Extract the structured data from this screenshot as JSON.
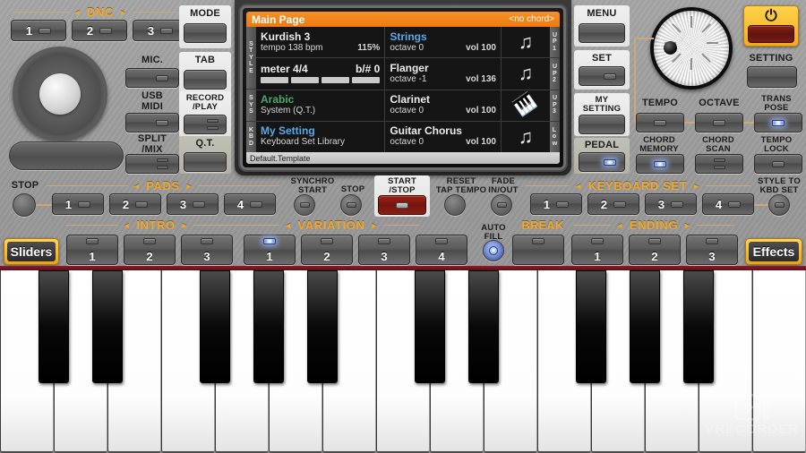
{
  "lcd": {
    "title": "Main Page",
    "chord": "<no chord>",
    "footer": "Default.Template",
    "side_left": [
      "STYLE",
      "SYS",
      "KBD"
    ],
    "side_right": [
      "UP1",
      "UP2",
      "UP3",
      "Low"
    ],
    "rows": [
      {
        "left_title": "Kurdish 3",
        "left_sub_a": "tempo 138 bpm",
        "left_sub_b": "115%",
        "right_title": "Strings",
        "right_sub_a": "octave 0",
        "right_sub_b": "vol 100",
        "icon": "music-note-icon"
      },
      {
        "left_title": "meter 4/4",
        "left_sub_a": "b/# 0",
        "left_sub_b": "",
        "right_title": "Flanger",
        "right_sub_a": "octave -1",
        "right_sub_b": "vol 136",
        "icon": "music-note-icon"
      },
      {
        "left_title": "Arabic",
        "left_sub_a": "System (Q.T.)",
        "left_sub_b": "",
        "right_title": "Clarinet",
        "right_sub_a": "octave 0",
        "right_sub_b": "vol 100",
        "icon": "clarinet-icon"
      },
      {
        "left_title": "My Setting",
        "left_sub_a": "Keyboard Set Library",
        "left_sub_b": "",
        "right_title": "Guitar Chorus",
        "right_sub_a": "octave 0",
        "right_sub_b": "vol 100",
        "icon": "music-note-icon"
      }
    ],
    "beat_segments": 4
  },
  "left_panel": {
    "dnc_label": "DNC",
    "dnc_buttons": [
      "1",
      "2",
      "3"
    ],
    "mic_label": "MIC.",
    "usb_midi_label": "USB\nMIDI",
    "split_mix_label": "SPLIT\n/MIX",
    "jog_wheel": "jog-wheel",
    "pitch_bar": "pitch-bend-bar"
  },
  "mode_column": {
    "items": [
      "MODE",
      "TAB",
      "RECORD\n/PLAY",
      "Q.T."
    ]
  },
  "right_column": {
    "items": [
      "MENU",
      "SET",
      "MY\nSETTING",
      "PEDAL"
    ]
  },
  "right_panel": {
    "dial": "value-dial",
    "power_label": "power-icon",
    "setting_label": "SETTING",
    "row1": [
      "TEMPO",
      "OCTAVE",
      "TRANS\nPOSE"
    ],
    "row2": [
      "CHORD\nMEMORY",
      "CHORD\nSCAN",
      "TEMPO\nLOCK"
    ]
  },
  "transport": {
    "stop_label": "STOP",
    "pads_label": "PADS",
    "pads": [
      "1",
      "2",
      "3",
      "4"
    ],
    "synchro_start": "SYNCHRO\nSTART",
    "synchro_stop": "STOP",
    "start_stop": "START\n/STOP",
    "reset_tap_tempo": "RESET\nTAP TEMPO",
    "fade_in_out": "FADE\nIN/OUT",
    "keyboard_set_label": "KEYBOARD SET",
    "keyboard_set": [
      "1",
      "2",
      "3",
      "4"
    ],
    "style_to_kbd_set": "STYLE TO\nKBD SET"
  },
  "styles": {
    "sliders_label": "Sliders",
    "effects_label": "Effects",
    "intro_label": "INTRO",
    "intro": [
      "1",
      "2",
      "3"
    ],
    "variation_label": "VARIATION",
    "variation": [
      "1",
      "2",
      "3",
      "4"
    ],
    "auto_fill": "AUTO\nFILL",
    "break_label": "BREAK",
    "ending_label": "ENDING",
    "ending": [
      "1",
      "2",
      "3"
    ]
  },
  "watermark": {
    "text": "VRECORDER"
  },
  "colors": {
    "accent_orange": "#f5a623",
    "lcd_header": "#ec7b10",
    "led_on": "#8fb4ff",
    "red_button": "#8d1f15",
    "gold": "#e8a417",
    "panel_gray": "#9a9a9a"
  }
}
